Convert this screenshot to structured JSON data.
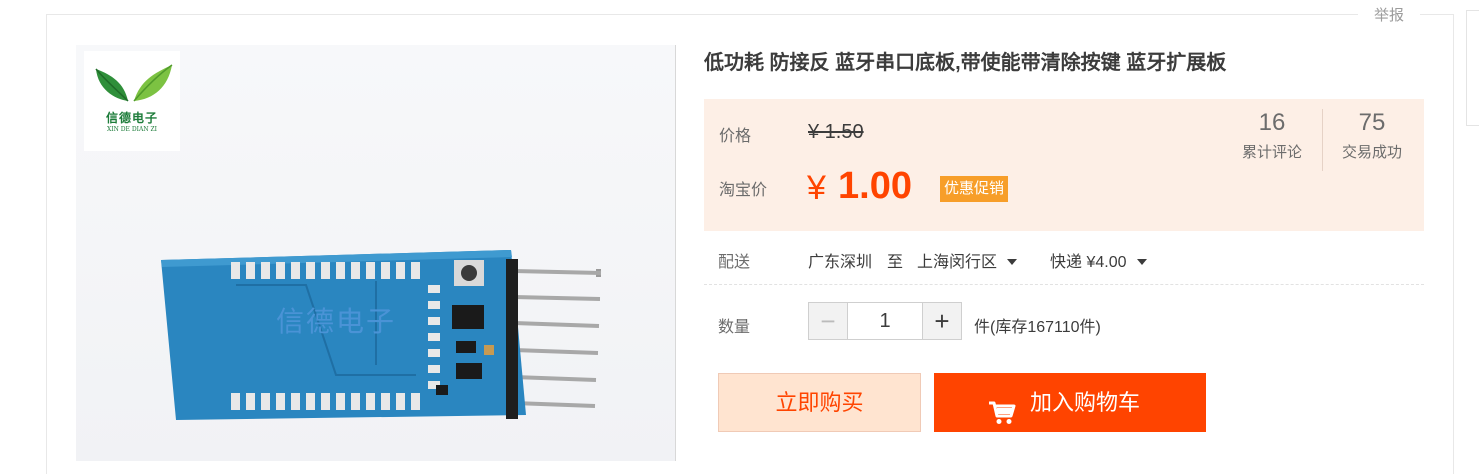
{
  "report_label": "举报",
  "product": {
    "title": "低功耗 防接反 蓝牙串口底板,带使能带清除按键 蓝牙扩展板",
    "image": {
      "brand_name": "信德电子",
      "brand_pinyin": "XIN DE DIAN ZI",
      "board_watermark": "信德电子"
    }
  },
  "price_panel": {
    "price_label": "价格",
    "original_price": "¥ 1.50",
    "taobao_label": "淘宝价",
    "currency": "¥",
    "current_price": "1.00",
    "promo_badge": "优惠促销",
    "review_count": "16",
    "review_label": "累计评论",
    "sales_count": "75",
    "sales_label": "交易成功"
  },
  "shipping": {
    "label": "配送",
    "origin": "广东深圳",
    "to": "至",
    "destination": "上海闵行区",
    "method": "快递 ¥4.00"
  },
  "quantity": {
    "label": "数量",
    "minus": "−",
    "value": "1",
    "plus": "+",
    "stock_text": "件(库存167110件)"
  },
  "actions": {
    "buy_now": "立即购买",
    "add_to_cart": "加入购物车"
  },
  "colors": {
    "accent": "#ff4400",
    "promo": "#f79e29",
    "panel_bg": "#fdefe6",
    "buy_now_bg": "#ffe4d0"
  }
}
